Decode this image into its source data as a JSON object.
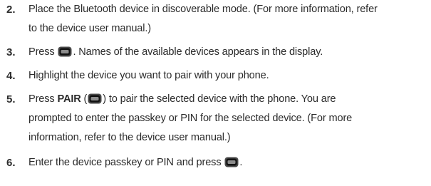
{
  "steps": [
    {
      "number": "2.",
      "lines": [
        "Place the Bluetooth device in discoverable mode. (For more information, refer",
        "to the device user manual.)"
      ]
    },
    {
      "number": "3.",
      "before_icon": "Press ",
      "after_icon": ". Names of the available devices appears in the display."
    },
    {
      "number": "4.",
      "text": "Highlight the device you want to pair with your phone."
    },
    {
      "number": "5.",
      "before_bold": "Press ",
      "bold": "PAIR",
      "before_icon": " (",
      "after_icon": ") to pair the selected device with the phone. You are",
      "lines": [
        "prompted to enter the passkey or PIN for the selected device. (For more",
        "information, refer to the device user manual.)"
      ]
    },
    {
      "number": "6.",
      "before_icon": "Enter the device passkey or PIN and press ",
      "after_icon": "."
    }
  ],
  "icons": {
    "key": "center-select-key-icon"
  }
}
